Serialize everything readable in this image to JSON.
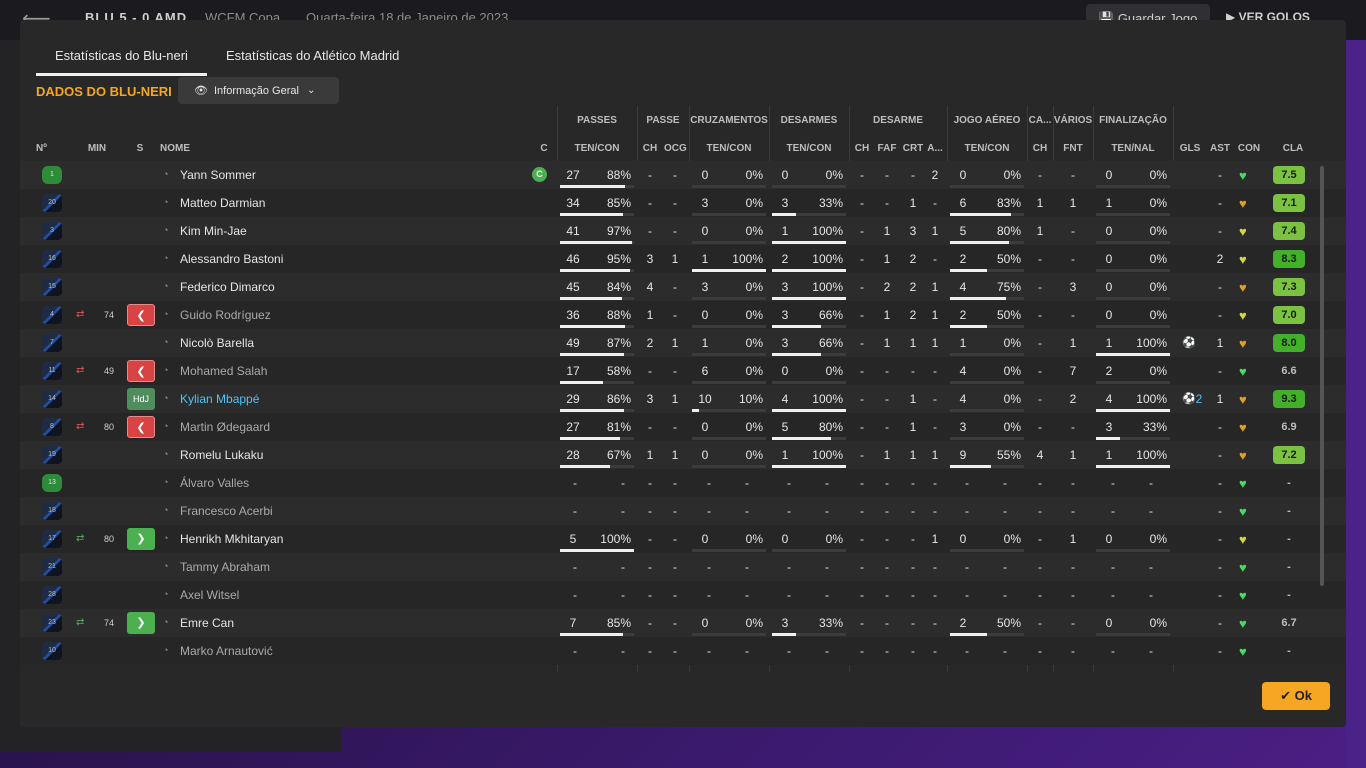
{
  "background": {
    "score": "BLU 5 - 0 AMD",
    "competition": "WCFM Copa",
    "date": "Quarta-feira 18 de Janeiro de 2023",
    "save_label": "Guardar Jogo",
    "goals_label": "VER GOLOS",
    "back_icon": "arrow-left-icon"
  },
  "tabs": [
    {
      "label": "Estatísticas do Blu-neri",
      "active": true
    },
    {
      "label": "Estatísticas do Atlético Madrid",
      "active": false
    }
  ],
  "section_title": "DADOS DO BLU-NERI",
  "view_dropdown": {
    "selected": "Informação Geral",
    "icon": "eye-icon"
  },
  "groups": {
    "passes": "PASSES",
    "passe": "PASSE",
    "cruz": "CRUZAMENTOS",
    "desarmes": "DESARMES",
    "desarme": "DESARME",
    "aereo": "JOGO AÉREO",
    "ca": "CA...",
    "varios": "VÁRIOS",
    "final": "FINALIZAÇÃO"
  },
  "columns": {
    "num": "Nº",
    "min": "MIN",
    "s": "S",
    "nome": "NOME",
    "c": "C",
    "passes": "TEN/CON",
    "passe_ch": "CH",
    "passe_ocg": "OCG",
    "cruz": "TEN/CON",
    "desarmes": "TEN/CON",
    "des_ch": "CH",
    "des_faf": "FAF",
    "des_crt": "CRT",
    "des_a": "A...",
    "aereo": "TEN/CON",
    "ca_ch": "CH",
    "var_fnt": "FNT",
    "final": "TEN/NAL",
    "gls": "GLS",
    "ast": "AST",
    "con": "CON",
    "cla": "CLA"
  },
  "ok_label": "Ok",
  "players": [
    {
      "num": "1",
      "gk": true,
      "name": "Yann Sommer",
      "cap": "C",
      "p": [
        "27",
        "88%"
      ],
      "pf": 0.88,
      "ch": "-",
      "ocg": "-",
      "cr": [
        "0",
        "0%"
      ],
      "crf": 0,
      "de": [
        "0",
        "0%"
      ],
      "def": 0,
      "dch": "-",
      "faf": "-",
      "crt": "-",
      "da": "2",
      "ae": [
        "0",
        "0%"
      ],
      "aef": 0,
      "cach": "-",
      "fnt": "-",
      "fi": [
        "0",
        "0%"
      ],
      "fif": 0,
      "gls": "",
      "ast": "-",
      "con": "#4cd964",
      "cla": "7.5",
      "clabg": "#7bc142"
    },
    {
      "num": "20",
      "name": "Matteo Darmian",
      "p": [
        "34",
        "85%"
      ],
      "pf": 0.85,
      "ch": "-",
      "ocg": "-",
      "cr": [
        "3",
        "0%"
      ],
      "crf": 0,
      "de": [
        "3",
        "33%"
      ],
      "def": 0.33,
      "dch": "-",
      "faf": "-",
      "crt": "1",
      "da": "-",
      "ae": [
        "6",
        "83%"
      ],
      "aef": 0.83,
      "cach": "1",
      "fnt": "1",
      "fi": [
        "1",
        "0%"
      ],
      "fif": 0,
      "gls": "",
      "ast": "-",
      "con": "#e0a030",
      "cla": "7.1",
      "clabg": "#7bc142"
    },
    {
      "num": "3",
      "name": "Kim Min-Jae",
      "p": [
        "41",
        "97%"
      ],
      "pf": 0.97,
      "ch": "-",
      "ocg": "-",
      "cr": [
        "0",
        "0%"
      ],
      "crf": 0,
      "de": [
        "1",
        "100%"
      ],
      "def": 1,
      "dch": "-",
      "faf": "1",
      "crt": "3",
      "da": "1",
      "ae": [
        "5",
        "80%"
      ],
      "aef": 0.8,
      "cach": "1",
      "fnt": "-",
      "fi": [
        "0",
        "0%"
      ],
      "fif": 0,
      "gls": "",
      "ast": "-",
      "con": "#d4d44a",
      "cla": "7.4",
      "clabg": "#7bc142"
    },
    {
      "num": "16",
      "name": "Alessandro Bastoni",
      "p": [
        "46",
        "95%"
      ],
      "pf": 0.95,
      "ch": "3",
      "ocg": "1",
      "cr": [
        "1",
        "100%"
      ],
      "crf": 1,
      "de": [
        "2",
        "100%"
      ],
      "def": 1,
      "dch": "-",
      "faf": "1",
      "crt": "2",
      "da": "-",
      "ae": [
        "2",
        "50%"
      ],
      "aef": 0.5,
      "cach": "-",
      "fnt": "-",
      "fi": [
        "0",
        "0%"
      ],
      "fif": 0,
      "gls": "",
      "ast": "2",
      "con": "#d4d44a",
      "cla": "8.3",
      "clabg": "#43b02a"
    },
    {
      "num": "15",
      "name": "Federico Dimarco",
      "p": [
        "45",
        "84%"
      ],
      "pf": 0.84,
      "ch": "4",
      "ocg": "-",
      "cr": [
        "3",
        "0%"
      ],
      "crf": 0,
      "de": [
        "3",
        "100%"
      ],
      "def": 1,
      "dch": "-",
      "faf": "2",
      "crt": "2",
      "da": "1",
      "ae": [
        "4",
        "75%"
      ],
      "aef": 0.75,
      "cach": "-",
      "fnt": "3",
      "fi": [
        "0",
        "0%"
      ],
      "fif": 0,
      "gls": "",
      "ast": "-",
      "con": "#e0a030",
      "cla": "7.3",
      "clabg": "#7bc142"
    },
    {
      "num": "4",
      "dim": true,
      "sub": "off",
      "min": "74",
      "badge": "off",
      "name": "Guido Rodríguez",
      "p": [
        "36",
        "88%"
      ],
      "pf": 0.88,
      "ch": "1",
      "ocg": "-",
      "cr": [
        "0",
        "0%"
      ],
      "crf": 0,
      "de": [
        "3",
        "66%"
      ],
      "def": 0.66,
      "dch": "-",
      "faf": "1",
      "crt": "2",
      "da": "1",
      "ae": [
        "2",
        "50%"
      ],
      "aef": 0.5,
      "cach": "-",
      "fnt": "-",
      "fi": [
        "0",
        "0%"
      ],
      "fif": 0,
      "gls": "",
      "ast": "-",
      "con": "#d4d44a",
      "cla": "7.0",
      "clabg": "#7bc142"
    },
    {
      "num": "7",
      "name": "Nicolò Barella",
      "p": [
        "49",
        "87%"
      ],
      "pf": 0.87,
      "ch": "2",
      "ocg": "1",
      "cr": [
        "1",
        "0%"
      ],
      "crf": 0,
      "de": [
        "3",
        "66%"
      ],
      "def": 0.66,
      "dch": "-",
      "faf": "1",
      "crt": "1",
      "da": "1",
      "ae": [
        "1",
        "0%"
      ],
      "aef": 0,
      "cach": "-",
      "fnt": "1",
      "fi": [
        "1",
        "100%"
      ],
      "fif": 1,
      "gls": "ball",
      "ast": "1",
      "con": "#e0a030",
      "cla": "8.0",
      "clabg": "#43b02a"
    },
    {
      "num": "11",
      "dim": true,
      "sub": "off",
      "min": "49",
      "badge": "off",
      "name": "Mohamed Salah",
      "p": [
        "17",
        "58%"
      ],
      "pf": 0.58,
      "ch": "-",
      "ocg": "-",
      "cr": [
        "6",
        "0%"
      ],
      "crf": 0,
      "de": [
        "0",
        "0%"
      ],
      "def": 0,
      "dch": "-",
      "faf": "-",
      "crt": "-",
      "da": "-",
      "ae": [
        "4",
        "0%"
      ],
      "aef": 0,
      "cach": "-",
      "fnt": "7",
      "fi": [
        "2",
        "0%"
      ],
      "fif": 0,
      "gls": "",
      "ast": "-",
      "con": "#4cd964",
      "cla": "6.6",
      "clabg": ""
    },
    {
      "num": "14",
      "hl": true,
      "badge": "hdj",
      "badge_text": "HdJ",
      "name": "Kylian Mbappé",
      "p": [
        "29",
        "86%"
      ],
      "pf": 0.86,
      "ch": "3",
      "ocg": "1",
      "cr": [
        "10",
        "10%"
      ],
      "crf": 0.1,
      "de": [
        "4",
        "100%"
      ],
      "def": 1,
      "dch": "-",
      "faf": "-",
      "crt": "1",
      "da": "-",
      "ae": [
        "4",
        "0%"
      ],
      "aef": 0,
      "cach": "-",
      "fnt": "2",
      "fi": [
        "4",
        "100%"
      ],
      "fif": 1,
      "gls": "ball2",
      "gls_n": "2",
      "ast": "1",
      "con": "#e0a030",
      "cla": "9.3",
      "clabg": "#43b02a"
    },
    {
      "num": "8",
      "dim": true,
      "sub": "off",
      "min": "80",
      "badge": "off",
      "name": "Martin Ødegaard",
      "p": [
        "27",
        "81%"
      ],
      "pf": 0.81,
      "ch": "-",
      "ocg": "-",
      "cr": [
        "0",
        "0%"
      ],
      "crf": 0,
      "de": [
        "5",
        "80%"
      ],
      "def": 0.8,
      "dch": "-",
      "faf": "-",
      "crt": "1",
      "da": "-",
      "ae": [
        "3",
        "0%"
      ],
      "aef": 0,
      "cach": "-",
      "fnt": "-",
      "fi": [
        "3",
        "33%"
      ],
      "fif": 0.33,
      "gls": "",
      "ast": "-",
      "con": "#e0a030",
      "cla": "6.9",
      "clabg": ""
    },
    {
      "num": "19",
      "name": "Romelu Lukaku",
      "p": [
        "28",
        "67%"
      ],
      "pf": 0.67,
      "ch": "1",
      "ocg": "1",
      "cr": [
        "0",
        "0%"
      ],
      "crf": 0,
      "de": [
        "1",
        "100%"
      ],
      "def": 1,
      "dch": "-",
      "faf": "1",
      "crt": "1",
      "da": "1",
      "ae": [
        "9",
        "55%"
      ],
      "aef": 0.55,
      "cach": "4",
      "fnt": "1",
      "fi": [
        "1",
        "100%"
      ],
      "fif": 1,
      "gls": "",
      "ast": "-",
      "con": "#e0a030",
      "cla": "7.2",
      "clabg": "#7bc142"
    },
    {
      "num": "13",
      "gk": true,
      "dim": true,
      "name": "Álvaro Valles",
      "empty": true,
      "con": "#4cd964",
      "cla": "-"
    },
    {
      "num": "18",
      "dim": true,
      "name": "Francesco Acerbi",
      "empty": true,
      "con": "#4cd964",
      "cla": "-"
    },
    {
      "num": "17",
      "sub": "on",
      "min": "80",
      "badge": "on",
      "name": "Henrikh Mkhitaryan",
      "p": [
        "5",
        "100%"
      ],
      "pf": 1,
      "ch": "-",
      "ocg": "-",
      "cr": [
        "0",
        "0%"
      ],
      "crf": 0,
      "de": [
        "0",
        "0%"
      ],
      "def": 0,
      "dch": "-",
      "faf": "-",
      "crt": "-",
      "da": "1",
      "ae": [
        "0",
        "0%"
      ],
      "aef": 0,
      "cach": "-",
      "fnt": "1",
      "fi": [
        "0",
        "0%"
      ],
      "fif": 0,
      "gls": "",
      "ast": "-",
      "con": "#d4d44a",
      "cla": "-",
      "clabg": ""
    },
    {
      "num": "21",
      "dim": true,
      "name": "Tammy Abraham",
      "empty": true,
      "con": "#4cd964",
      "cla": "-"
    },
    {
      "num": "28",
      "dim": true,
      "name": "Axel Witsel",
      "empty": true,
      "con": "#4cd964",
      "cla": "-"
    },
    {
      "num": "23",
      "sub": "on",
      "min": "74",
      "badge": "on",
      "name": "Emre Can",
      "p": [
        "7",
        "85%"
      ],
      "pf": 0.85,
      "ch": "-",
      "ocg": "-",
      "cr": [
        "0",
        "0%"
      ],
      "crf": 0,
      "de": [
        "3",
        "33%"
      ],
      "def": 0.33,
      "dch": "-",
      "faf": "-",
      "crt": "-",
      "da": "-",
      "ae": [
        "2",
        "50%"
      ],
      "aef": 0.5,
      "cach": "-",
      "fnt": "-",
      "fi": [
        "0",
        "0%"
      ],
      "fif": 0,
      "gls": "",
      "ast": "-",
      "con": "#4cd964",
      "cla": "6.7",
      "clabg": ""
    },
    {
      "num": "10",
      "dim": true,
      "name": "Marko Arnautović",
      "empty": true,
      "con": "#4cd964",
      "cla": "-"
    }
  ]
}
